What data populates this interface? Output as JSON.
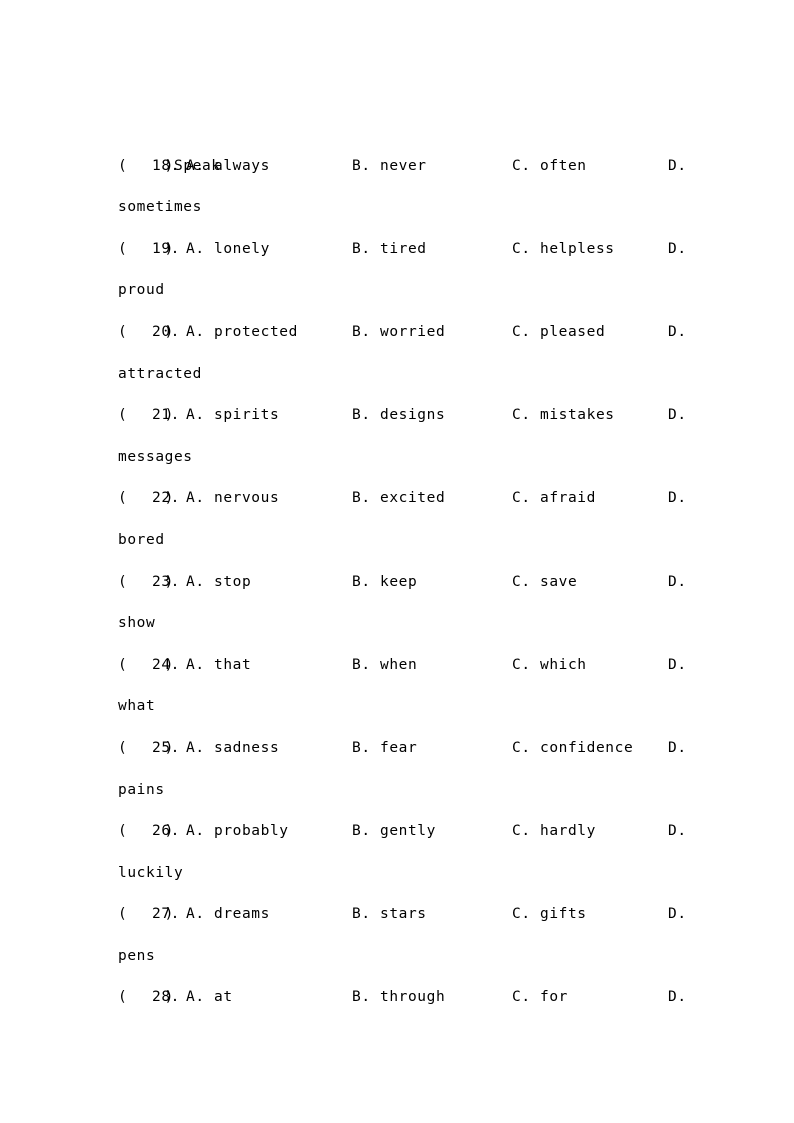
{
  "document": {
    "heading_line": "Speak",
    "marker": "(    )",
    "rows": [
      {
        "number": "18.",
        "a": "A. always",
        "b": "B. never",
        "c": "C. often",
        "d": "D.",
        "wrap": "sometimes"
      },
      {
        "number": "19.",
        "a": "A. lonely",
        "b": "B. tired",
        "c": "C. helpless",
        "d": "D.",
        "wrap": "proud"
      },
      {
        "number": "20.",
        "a": "A. protected",
        "b": "B. worried",
        "c": "C. pleased",
        "d": "D.",
        "wrap": "attracted"
      },
      {
        "number": "21.",
        "a": "A. spirits",
        "b": "B. designs",
        "c": "C. mistakes",
        "d": "D.",
        "wrap": "messages"
      },
      {
        "number": "22.",
        "a": "A. nervous",
        "b": "B. excited",
        "c": "C. afraid",
        "d": "D.",
        "wrap": "bored"
      },
      {
        "number": "23.",
        "a": "A. stop",
        "b": "B. keep",
        "c": "C. save",
        "d": "D.",
        "wrap": "show"
      },
      {
        "number": "24.",
        "a": "A. that",
        "b": "B. when",
        "c": "C. which",
        "d": "D.",
        "wrap": "what"
      },
      {
        "number": "25.",
        "a": "A. sadness",
        "b": "B. fear",
        "c": "C. confidence",
        "d": "D.",
        "wrap": "pains"
      },
      {
        "number": "26.",
        "a": "A. probably",
        "b": "B. gently",
        "c": "C. hardly",
        "d": "D.",
        "wrap": "luckily"
      },
      {
        "number": "27.",
        "a": "A. dreams",
        "b": "B. stars",
        "c": "C. gifts",
        "d": "D.",
        "wrap": "pens"
      },
      {
        "number": "28.",
        "a": "A. at",
        "b": "B. through",
        "c": "C. for",
        "d": "D.",
        "wrap": ""
      }
    ]
  }
}
